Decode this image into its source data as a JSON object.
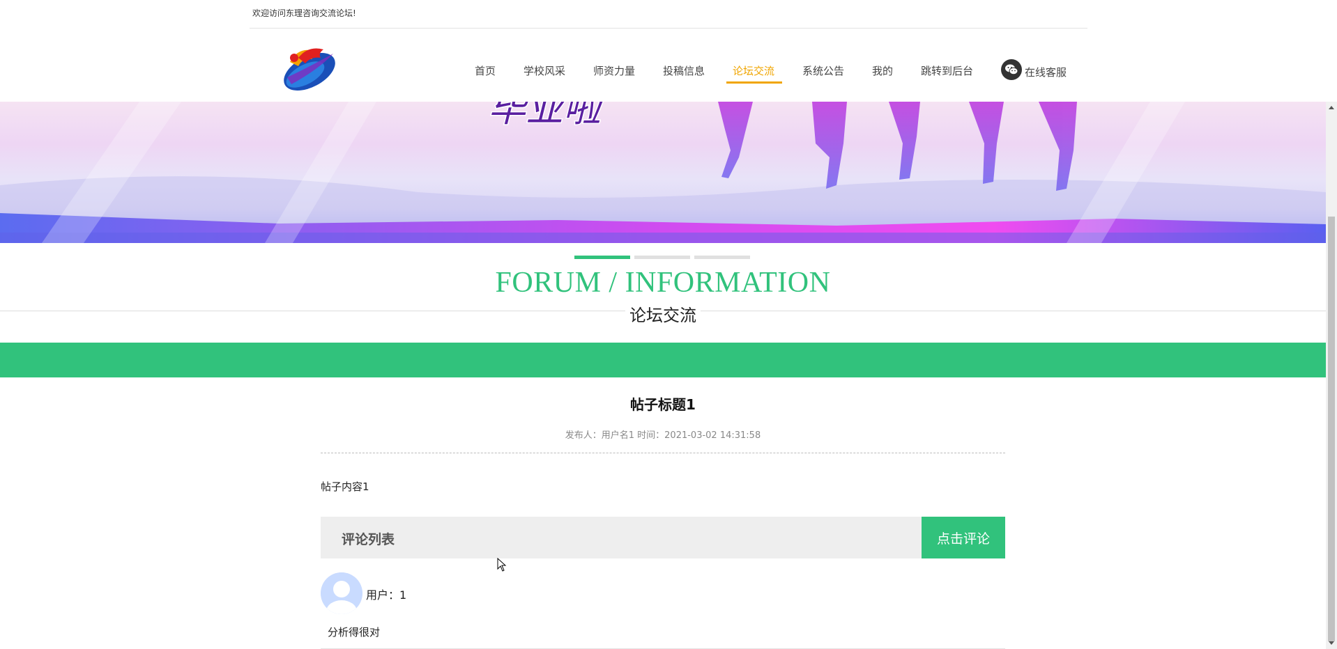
{
  "topbar": {
    "welcome": "欢迎访问东理咨询交流论坛!"
  },
  "nav": {
    "items": [
      {
        "label": "首页",
        "active": false
      },
      {
        "label": "学校风采",
        "active": false
      },
      {
        "label": "师资力量",
        "active": false
      },
      {
        "label": "投稿信息",
        "active": false
      },
      {
        "label": "论坛交流",
        "active": true
      },
      {
        "label": "系统公告",
        "active": false
      },
      {
        "label": "我的",
        "active": false
      },
      {
        "label": "跳转到后台",
        "active": false
      }
    ],
    "service_label": "在线客服",
    "service_icon": "wechat-icon",
    "active_color": "#f0a500"
  },
  "carousel": {
    "slide_count": 3,
    "active_index": 0
  },
  "section": {
    "title_en": "FORUM / INFORMATION",
    "title_cn": "论坛交流",
    "accent": "#31c27c"
  },
  "post": {
    "title": "帖子标题1",
    "meta": "发布人：用户名1 时间：2021-03-02 14:31:58",
    "content": "帖子内容1"
  },
  "comments": {
    "header": "评论列表",
    "button": "点击评论",
    "items": [
      {
        "user_label": "用户：1",
        "text": "分析得很对"
      }
    ]
  }
}
